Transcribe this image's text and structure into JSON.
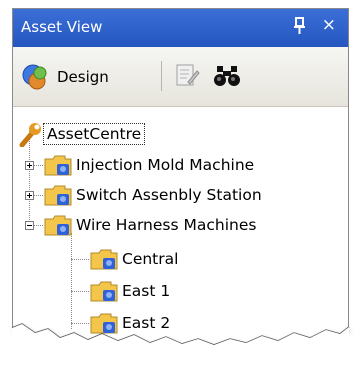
{
  "window": {
    "title": "Asset View",
    "close_glyph": "×"
  },
  "toolbar": {
    "design_label": "Design"
  },
  "tree": {
    "root": "AssetCentre",
    "items": [
      {
        "label": "Injection Mold Machine",
        "expanded": false
      },
      {
        "label": "Switch Assenbly Station",
        "expanded": false
      },
      {
        "label": "Wire Harness Machines",
        "expanded": true
      }
    ],
    "children": [
      {
        "label": "Central"
      },
      {
        "label": "East 1"
      },
      {
        "label": "East 2"
      }
    ]
  },
  "colors": {
    "titlebar": "#2c5fcb",
    "folder": "#f3c64b",
    "folder_badge": "#2f62d8"
  }
}
